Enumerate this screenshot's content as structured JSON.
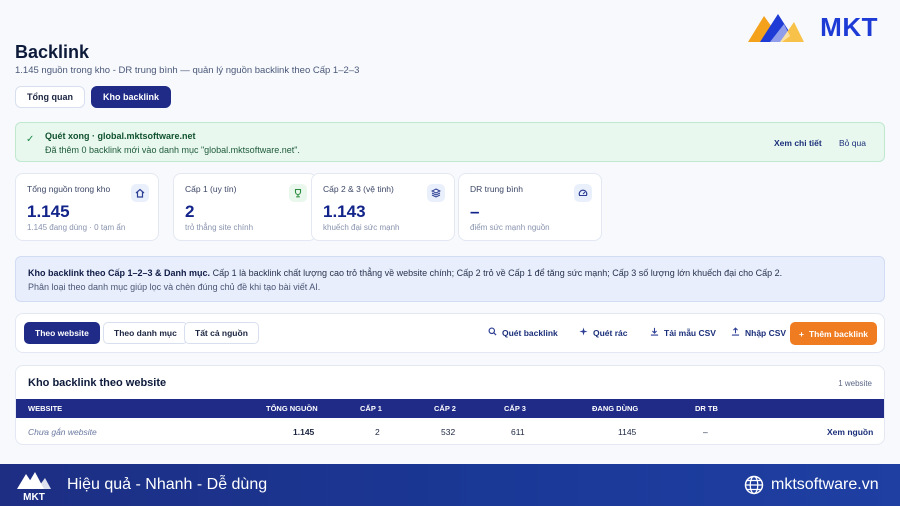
{
  "brand": {
    "name": "MKT"
  },
  "header": {
    "title": "Backlink",
    "subtitle": "1.145 nguồn trong kho - DR trung bình — quản lý nguồn backlink theo Cấp 1–2–3"
  },
  "tabs": [
    {
      "label": "Tổng quan",
      "active": false
    },
    {
      "label": "Kho backlink",
      "active": true
    }
  ],
  "banner": {
    "title": "Quét xong · global.mktsoftware.net",
    "desc": "Đã thêm 0 backlink mới vào danh mục \"global.mktsoftware.net\".",
    "detail_label": "Xem chi tiết",
    "skip_label": "Bỏ qua"
  },
  "stats": [
    {
      "label": "Tổng nguồn trong kho",
      "value": "1.145",
      "sub": "1.145 đang dùng · 0 tạm ẩn",
      "icon": "home-icon"
    },
    {
      "label": "Cấp 1 (uy tín)",
      "value": "2",
      "sub": "trỏ thẳng site chính",
      "icon": "trophy-icon"
    },
    {
      "label": "Cấp 2 & 3 (vệ tinh)",
      "value": "1.143",
      "sub": "khuếch đại sức mạnh",
      "icon": "layers-icon"
    },
    {
      "label": "DR trung bình",
      "value": "–",
      "sub": "điểm sức mạnh nguồn",
      "icon": "gauge-icon"
    }
  ],
  "info": {
    "heading": "Kho backlink theo Cấp 1–2–3 & Danh mục.",
    "line1": " Cấp 1 là backlink chất lượng cao trỏ thẳng về website chính; Cấp 2 trỏ về Cấp 1 để tăng sức mạnh; Cấp 3 số lượng lớn khuếch đại cho Cấp 2.",
    "line2": "Phân loại theo danh mục giúp lọc và chèn đúng chủ đề khi tạo bài viết AI."
  },
  "toolbar": {
    "views": [
      {
        "label": "Theo website",
        "active": true
      },
      {
        "label": "Theo danh mục",
        "active": false
      },
      {
        "label": "Tất cả nguồn",
        "active": false
      }
    ],
    "scan_label": "Quét backlink",
    "spam_label": "Quét rác",
    "download_label": "Tải mẫu CSV",
    "import_label": "Nhập CSV",
    "add_label": "Thêm backlink"
  },
  "table": {
    "title": "Kho backlink theo website",
    "count": "1 website",
    "columns": [
      "WEBSITE",
      "TỔNG NGUỒN",
      "CẤP 1",
      "CẤP 2",
      "CẤP 3",
      "ĐANG DÙNG",
      "DR TB"
    ],
    "rows": [
      {
        "website": "Chưa gắn website",
        "total": "1.145",
        "lvl1": "2",
        "lvl2": "532",
        "lvl3": "611",
        "in_use": "1145",
        "dr": "–",
        "action": "Xem nguồn"
      }
    ]
  },
  "footer": {
    "logo_text": "MKT",
    "slogan": "Hiệu quả - Nhanh - Dễ dùng",
    "site": "mktsoftware.vn"
  },
  "colors": {
    "primary": "#1f2b86",
    "accent": "#f07c22",
    "success_bg": "#e9f8ef",
    "info_bg": "#e8eefb",
    "value": "#12238a"
  }
}
